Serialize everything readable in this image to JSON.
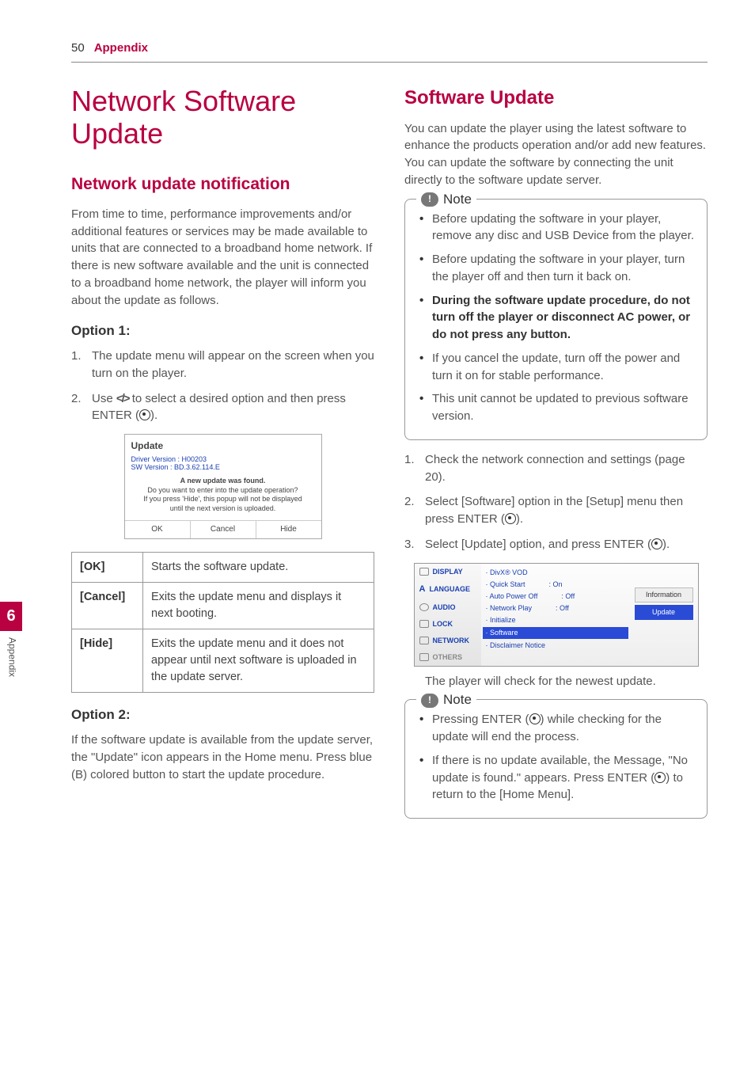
{
  "header": {
    "page": "50",
    "crumb": "Appendix"
  },
  "side_tab": {
    "num": "6",
    "label": "Appendix"
  },
  "left": {
    "h1": "Network Software Update",
    "h2": "Network update notification",
    "intro": "From time to time, performance improvements and/or additional features or services may be made available to units that are connected to a broadband home network. If there is new software available and the unit is connected to a broadband home network, the player will inform you about the update as follows.",
    "opt1_title": "Option 1:",
    "opt1_step1": "The update menu will appear on the screen when you turn on the player.",
    "opt1_step2a": "Use ",
    "opt1_step2b": " to select a desired option and then press ENTER (",
    "opt1_step2c": ").",
    "arrows": "</>",
    "dialog": {
      "title": "Update",
      "line1": "Driver Version : H00203",
      "line2": "SW Version : BD.3.62.114.E",
      "msg1": "A new update was found.",
      "msg2": "Do you want to enter into the update operation?",
      "msg3": "If you press 'Hide', this popup will not be displayed",
      "msg4": "until the next version is uploaded.",
      "btn_ok": "OK",
      "btn_cancel": "Cancel",
      "btn_hide": "Hide"
    },
    "table": {
      "r1k": "[OK]",
      "r1v": "Starts the software update.",
      "r2k": "[Cancel]",
      "r2v": "Exits the update menu and displays it next booting.",
      "r3k": "[Hide]",
      "r3v": "Exits the update menu and it does not appear until next software is uploaded in the update server."
    },
    "opt2_title": "Option 2:",
    "opt2_para": "If the software update is available from the update server, the \"Update\" icon appears in the Home menu. Press blue (B) colored button to start the update procedure."
  },
  "right": {
    "h2": "Software Update",
    "intro": "You can update the player using the latest software to enhance the products operation and/or add new features. You can update the software by connecting the unit directly to the software update server.",
    "note1_label": "Note",
    "note1_items": [
      "Before updating the software in your player, remove any disc and USB Device from the player.",
      "Before updating the software in your player, turn the player off and then turn it back on.",
      "During the software update procedure, do not turn off the player or disconnect AC power, or do not press any button.",
      "If you cancel the update, turn off the power and turn it on for stable performance.",
      "This unit cannot be updated to previous software version."
    ],
    "step1": "Check the network connection and settings (page 20).",
    "step2a": "Select [Software] option in the [Setup] menu then press ENTER (",
    "step2b": ").",
    "step3a": "Select [Update] option, and press ENTER (",
    "step3b": ").",
    "setup": {
      "side": [
        "DISPLAY",
        "LANGUAGE",
        "AUDIO",
        "LOCK",
        "NETWORK",
        "OTHERS"
      ],
      "rows": [
        {
          "l": "· DivX® VOD",
          "r": ""
        },
        {
          "l": "· Quick Start",
          "r": ": On"
        },
        {
          "l": "· Auto Power Off",
          "r": ": Off"
        },
        {
          "l": "· Network Play",
          "r": ": Off"
        },
        {
          "l": "· Initialize",
          "r": ""
        },
        {
          "l": "· Software",
          "r": "",
          "sel": true
        },
        {
          "l": "· Disclaimer Notice",
          "r": ""
        }
      ],
      "right": [
        "Information",
        "Update"
      ]
    },
    "after_setup": "The player will check for the newest update.",
    "note2_label": "Note",
    "note2_item1a": "Pressing ENTER (",
    "note2_item1b": ") while checking for the update will end the process.",
    "note2_item2a": "If there is no update available, the Message, \"No update is found.\" appears. Press ENTER (",
    "note2_item2b": ") to return to the [Home Menu]."
  }
}
